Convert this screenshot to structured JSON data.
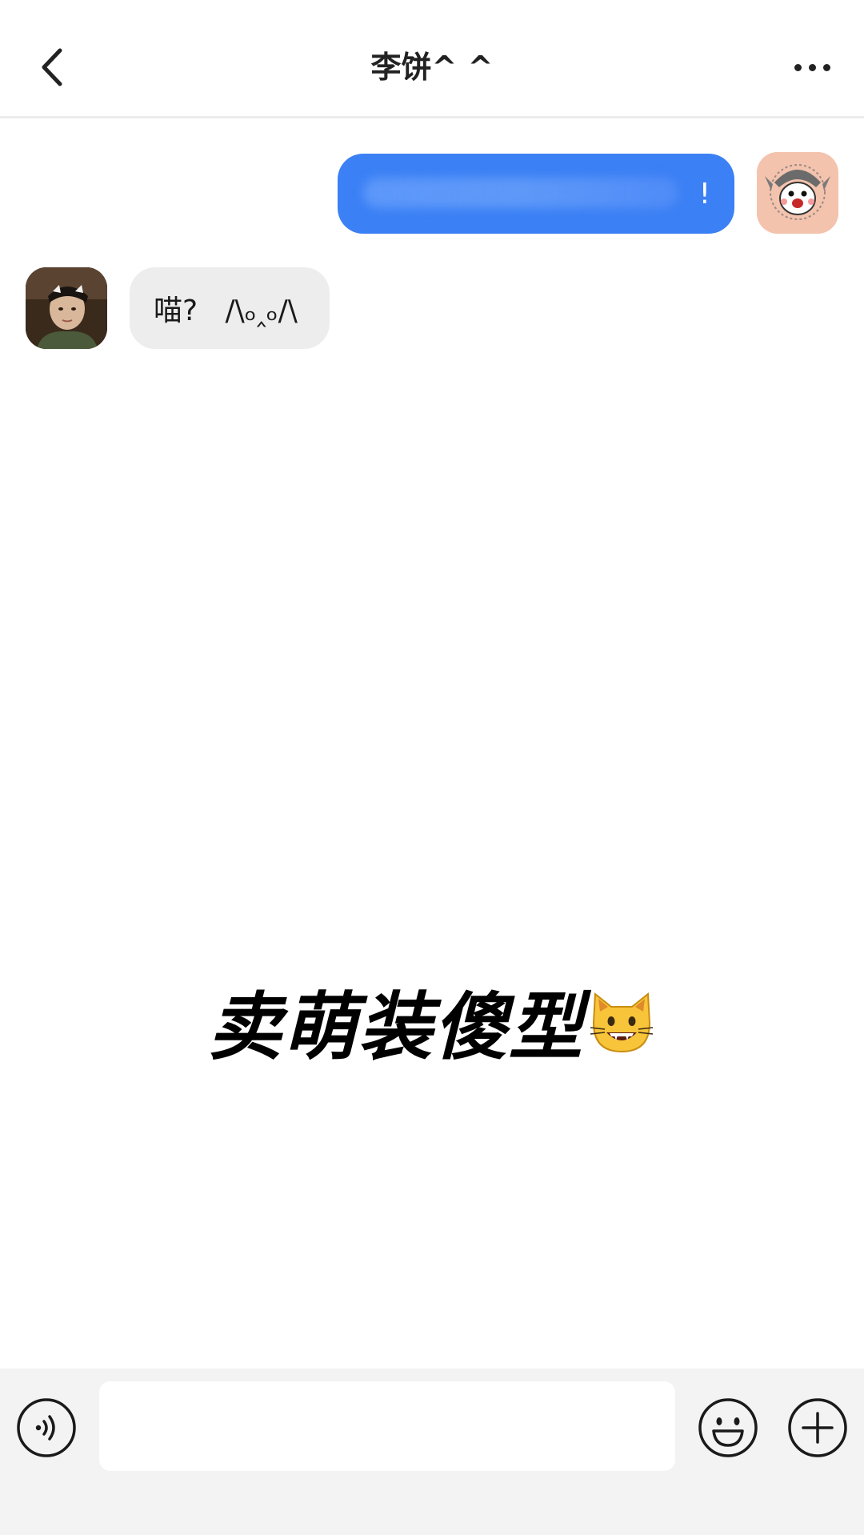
{
  "header": {
    "title": "李饼^ ^"
  },
  "messages": [
    {
      "direction": "outgoing",
      "text": "!",
      "bubble_color": "#3b80f5"
    },
    {
      "direction": "incoming",
      "text": "喵?   /\\ₒ‸ₒ/\\",
      "bubble_color": "#ededed"
    }
  ],
  "caption": {
    "text": "卖萌装傻型",
    "icon": "grinning-cat-emoji-icon"
  },
  "input_bar": {
    "placeholder": "",
    "value": "",
    "icons": [
      "voice-icon",
      "emoji-icon",
      "plus-icon"
    ]
  },
  "colors": {
    "accent": "#3b80f5",
    "incoming_bubble": "#ededed",
    "input_bar_bg": "#f3f3f3"
  }
}
